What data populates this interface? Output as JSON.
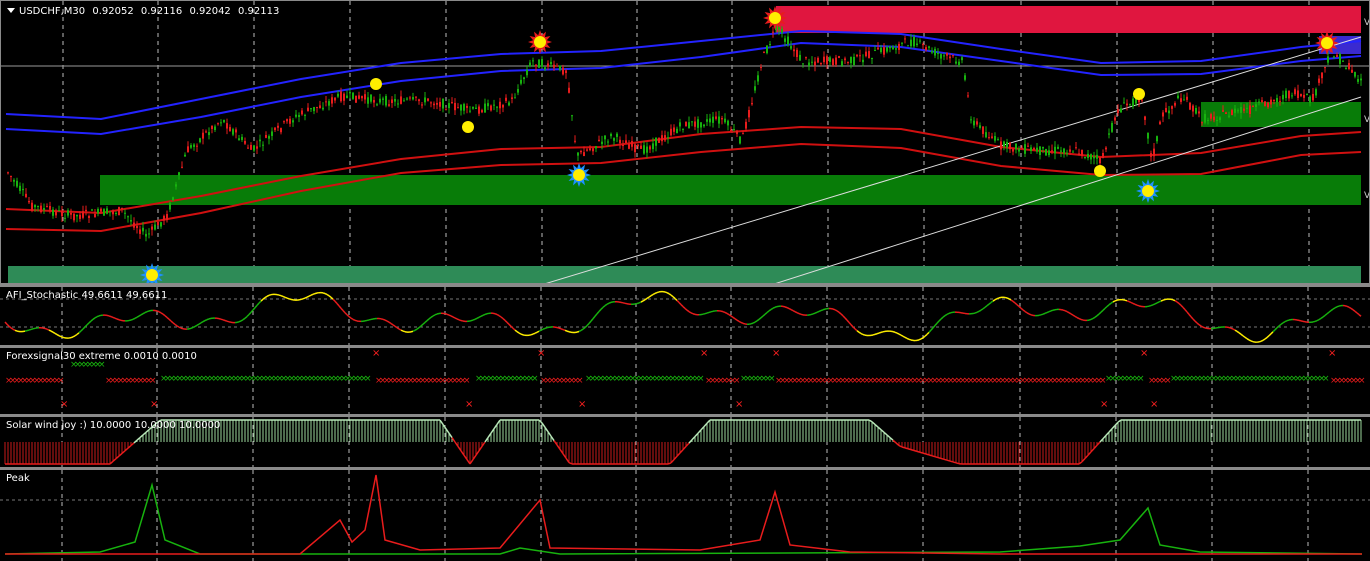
{
  "main": {
    "symbol": "USDCHF,M30",
    "open": "0.92052",
    "high": "0.92116",
    "low": "0.92042",
    "close": "0.92113",
    "right_marker": "V",
    "colors": {
      "bull": "#17b20e",
      "bear": "#e81c1c",
      "envelope_blue": "#2323ff",
      "envelope_red": "#d01010",
      "zone_green": "#087c08",
      "zone_red": "#e0163f"
    }
  },
  "indicators": [
    {
      "id": "stoch",
      "title": "AFI_Stochastic 49.6611 49.6611"
    },
    {
      "id": "forexsignal",
      "title": "Forexsignal30 extreme 0.0010 0.0010"
    },
    {
      "id": "solar",
      "title": "Solar wind joy :) 10.0000 10.0000 10.0000"
    },
    {
      "id": "peak",
      "title": "Peak"
    }
  ]
}
